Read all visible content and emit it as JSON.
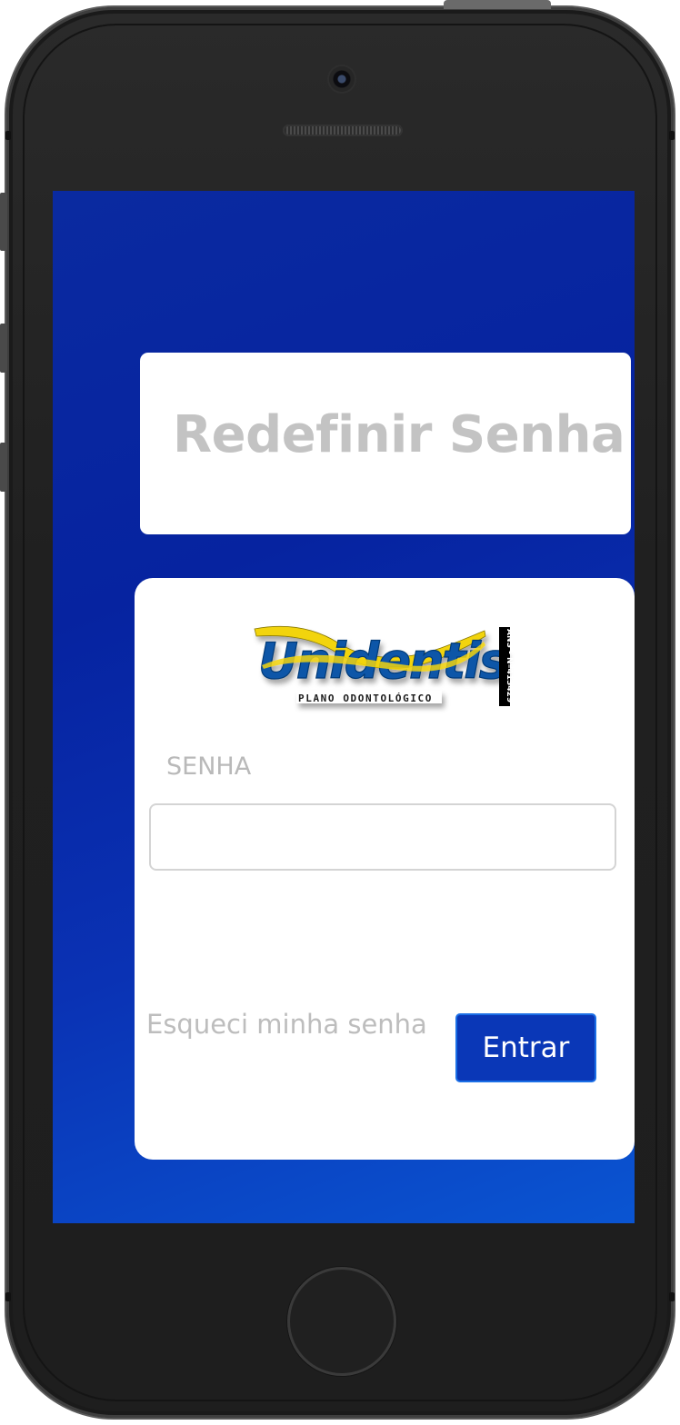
{
  "page": {
    "title": "Redefinir Senha"
  },
  "logo": {
    "brand": "Unidentis",
    "tagline": "PLANO ODONTOLÓGICO",
    "ans": "ANS - Nº413429",
    "colors": {
      "blue": "#0b56a8",
      "yellow": "#f2d40f"
    }
  },
  "form": {
    "password_label": "SENHA",
    "password_value": "",
    "forgot_link": "Esqueci minha senha",
    "submit_label": "Entrar"
  },
  "colors": {
    "background_gradient_start": "#0623a0",
    "background_gradient_end": "#0a55d2",
    "button": "#0a37b7",
    "muted_text": "#bdbdbd"
  },
  "device": {
    "icons": [
      "camera-icon",
      "speaker-grille",
      "home-button"
    ]
  }
}
